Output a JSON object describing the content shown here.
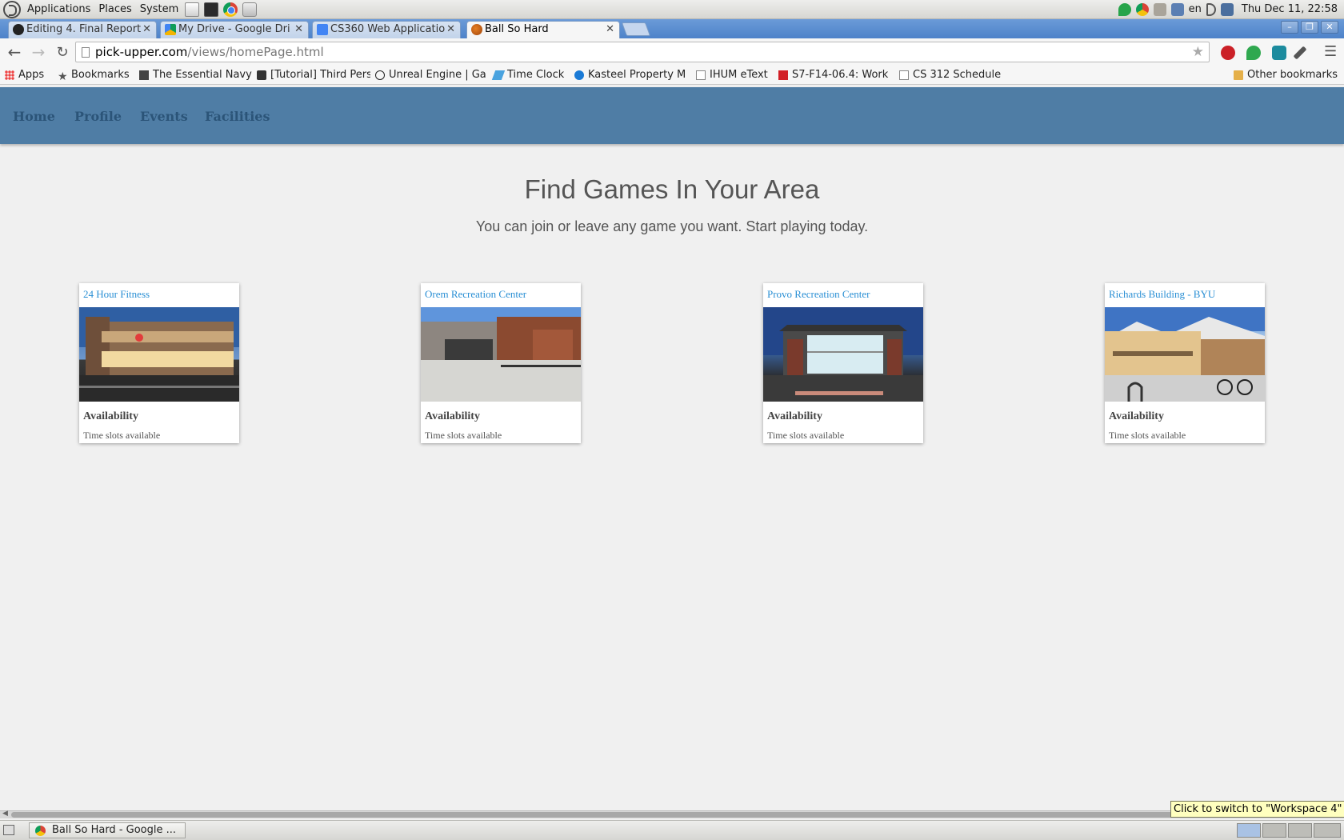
{
  "top_panel": {
    "menus": [
      "Applications",
      "Places",
      "System"
    ],
    "keyboard_layout": "en",
    "clock": "Thu Dec 11, 22:58"
  },
  "browser": {
    "tabs": [
      {
        "title": "Editing 4. Final Report",
        "icon": "github-icon",
        "active": false
      },
      {
        "title": "My Drive - Google Dri",
        "icon": "google-drive-icon",
        "active": false
      },
      {
        "title": "CS360 Web Applicatio",
        "icon": "google-docs-icon",
        "active": false
      },
      {
        "title": "Ball So Hard",
        "icon": "basketball-icon",
        "active": true
      }
    ],
    "address": {
      "host": "pick-upper.com",
      "path": "/views/homePage.html"
    },
    "bookmarks": [
      {
        "label": "Apps",
        "icon": "apps-grid-icon"
      },
      {
        "label": "Bookmarks",
        "icon": "star-icon"
      },
      {
        "label": "The Essential Navy",
        "icon": "bookmark-page-icon"
      },
      {
        "label": "[Tutorial] Third Pers",
        "icon": "epic-games-icon"
      },
      {
        "label": "Unreal Engine | Ga",
        "icon": "unreal-engine-icon"
      },
      {
        "label": "Time Clock",
        "icon": "time-clock-icon"
      },
      {
        "label": "Kasteel Property M",
        "icon": "kasteel-icon"
      },
      {
        "label": "IHUM eText",
        "icon": "page-icon"
      },
      {
        "label": "S7-F14-06.4: Work",
        "icon": "webassign-icon"
      },
      {
        "label": "CS 312 Schedule",
        "icon": "page-icon"
      }
    ],
    "other_bookmarks": "Other bookmarks"
  },
  "site": {
    "nav": [
      "Home",
      "Profile",
      "Events",
      "Facilities"
    ],
    "hero_title": "Find Games In Your Area",
    "hero_subtitle": "You can join or leave any game you want. Start playing today.",
    "facilities": [
      {
        "name": "24 Hour Fitness",
        "label": "Availability",
        "value": "Time slots available"
      },
      {
        "name": "Orem Recreation Center",
        "label": "Availability",
        "value": "Time slots available"
      },
      {
        "name": "Provo Recreation Center",
        "label": "Availability",
        "value": "Time slots available"
      },
      {
        "name": "Richards Building - BYU",
        "label": "Availability",
        "value": "Time slots available"
      }
    ]
  },
  "bottom_panel": {
    "task": "Ball So Hard - Google ...",
    "tooltip": "Click to switch to \"Workspace 4\""
  }
}
